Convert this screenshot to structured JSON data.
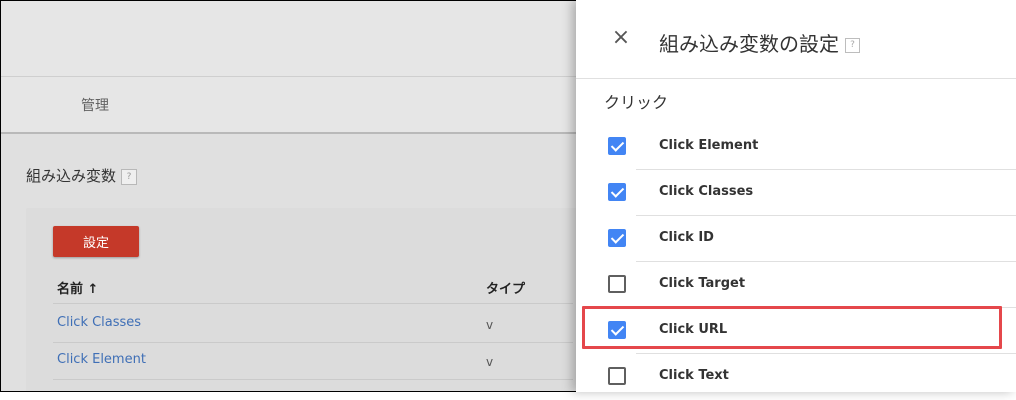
{
  "background": {
    "nav_admin": "管理",
    "section_title": "組み込み変数",
    "help_mark": "?",
    "set_button": "設定",
    "table": {
      "col_name": "名前 ↑",
      "col_type": "タイプ",
      "rows": [
        {
          "name": "Click Classes",
          "type": "v"
        },
        {
          "name": "Click Element",
          "type": "v"
        }
      ]
    }
  },
  "panel": {
    "close_icon": "×",
    "title": "組み込み変数の設定",
    "help_mark": "?",
    "group": "クリック",
    "items": [
      {
        "label": "Click Element",
        "checked": true
      },
      {
        "label": "Click Classes",
        "checked": true
      },
      {
        "label": "Click ID",
        "checked": true
      },
      {
        "label": "Click Target",
        "checked": false
      },
      {
        "label": "Click URL",
        "checked": true
      },
      {
        "label": "Click Text",
        "checked": false
      }
    ]
  },
  "colors": {
    "accent_blue": "#4285f4",
    "button_red": "#c53929",
    "highlight_red": "#e5474b",
    "link_blue": "#3f6fb6"
  }
}
